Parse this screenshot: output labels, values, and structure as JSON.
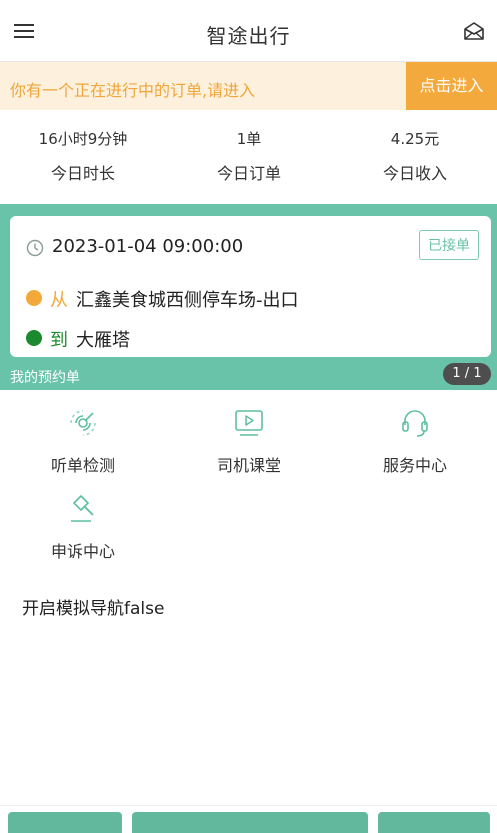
{
  "header": {
    "title": "智途出行",
    "menu_icon": "menu-icon",
    "mail_icon": "mail-icon"
  },
  "banner": {
    "text": "你有一个正在进行中的订单,请进入",
    "button_label": "点击进入"
  },
  "stats": [
    {
      "value": "16小时9分钟",
      "label": "今日时长"
    },
    {
      "value": "1单",
      "label": "今日订单"
    },
    {
      "value": "4.25元",
      "label": "今日收入"
    }
  ],
  "order": {
    "time": "2023-01-04 09:00:00",
    "status": "已接单",
    "from_tag": "从",
    "from_place": "汇鑫美食城西侧停车场-出口",
    "to_tag": "到",
    "to_place": "大雁塔"
  },
  "reservation": {
    "label": "我的预约单",
    "pager": "1 / 1"
  },
  "menu_items": [
    {
      "label": "听单检测",
      "icon": "order-listening-icon"
    },
    {
      "label": "司机课堂",
      "icon": "driver-class-icon"
    },
    {
      "label": "服务中心",
      "icon": "headset-icon"
    },
    {
      "label": "申诉中心",
      "icon": "gavel-icon"
    }
  ],
  "nav_toggle": "开启模拟导航false",
  "colors": {
    "accent_green": "#69c3a8",
    "accent_orange": "#f4a93c",
    "to_green": "#1b8a2e"
  }
}
